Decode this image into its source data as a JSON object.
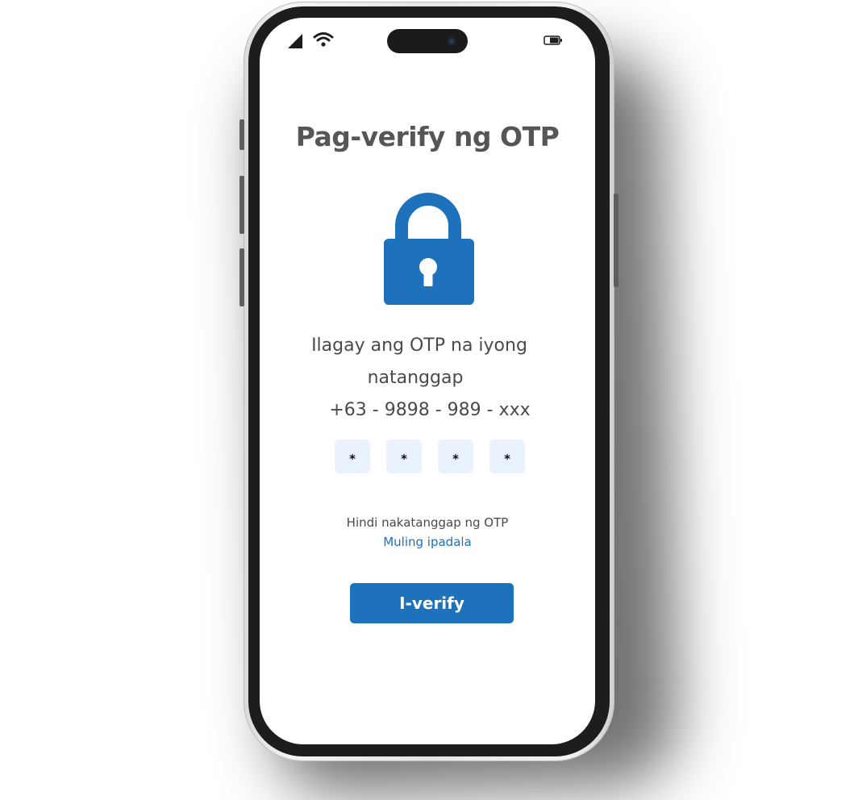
{
  "screen": {
    "title": "Pag-verify ng OTP",
    "instruction_line1": "Ilagay ang OTP na iyong",
    "instruction_line2": "natanggap",
    "phone_number": "+63 - 9898 - 989 - xxx",
    "otp_digits": [
      "*",
      "*",
      "*",
      "*"
    ],
    "not_received_text": "Hindi nakatanggap ng OTP",
    "resend_link": "Muling ipadala",
    "verify_button": "I-verify"
  },
  "status_bar": {
    "icons": [
      "signal-icon",
      "wifi-icon",
      "battery-icon"
    ]
  },
  "icons": {
    "main": "lock-icon"
  },
  "colors": {
    "accent": "#1E72BC",
    "otp_box_bg": "#E9F2FD",
    "title_text": "#565656",
    "body_text": "#4A4A4A",
    "link": "#1E6FBD"
  }
}
